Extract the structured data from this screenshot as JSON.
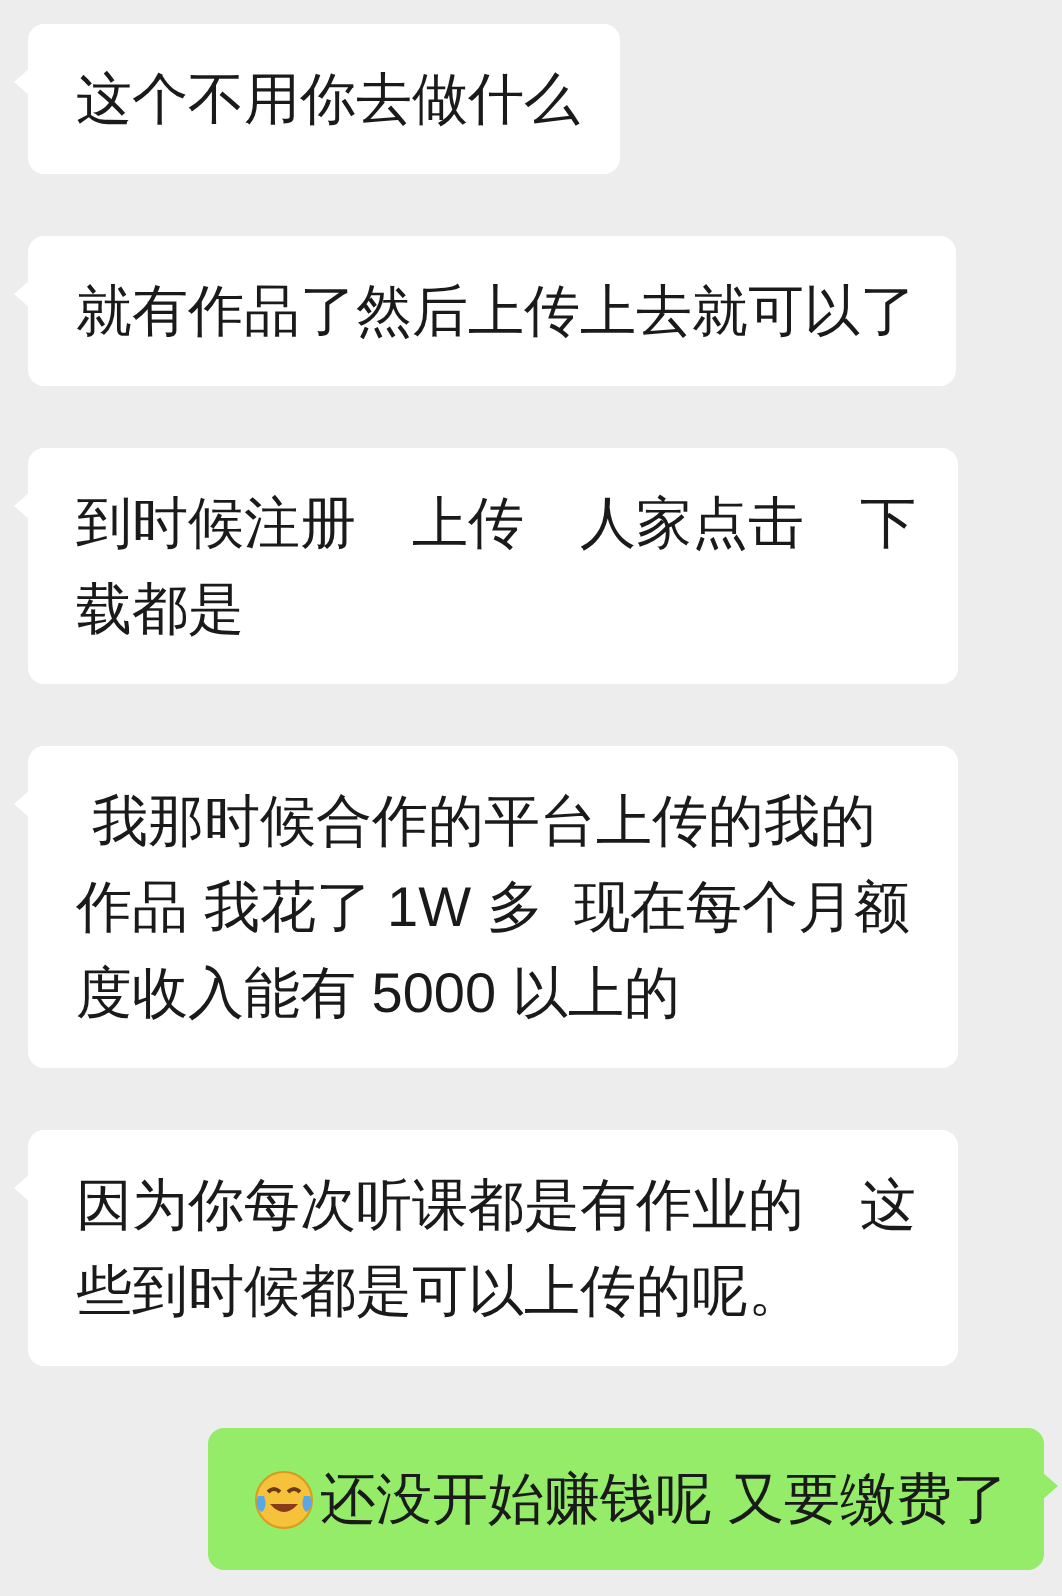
{
  "messages": [
    {
      "kind": "received",
      "text": "这个不用你去做什么"
    },
    {
      "kind": "received",
      "text": "就有作品了然后上传上去就可以了"
    },
    {
      "kind": "received",
      "text": "到时候注册　上传　人家点击　下载都是"
    },
    {
      "kind": "received",
      "text": " 我那时候合作的平台上传的我的作品 我花了 1W 多  现在每个月额度收入能有 5000 以上的"
    },
    {
      "kind": "received",
      "text": "因为你每次听课都是有作业的　这些到时候都是可以上传的呢。"
    },
    {
      "kind": "sent",
      "emoji": true,
      "text": "还没开始赚钱呢 又要缴费了"
    }
  ]
}
